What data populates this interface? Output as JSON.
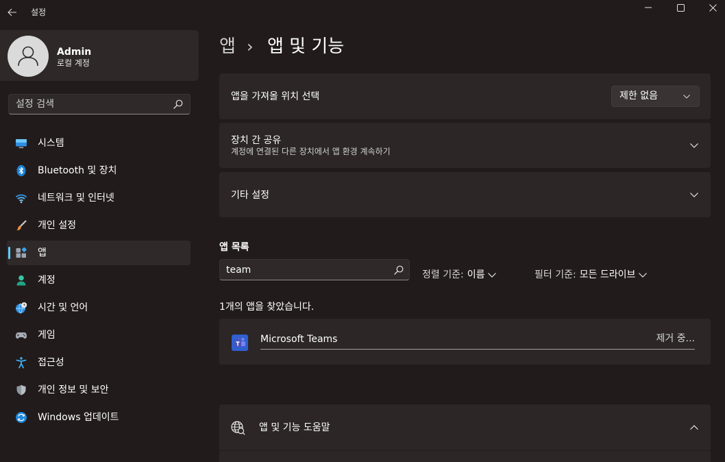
{
  "window": {
    "title": "설정"
  },
  "profile": {
    "name": "Admin",
    "account_type": "로컬 계정"
  },
  "search": {
    "placeholder": "설정 검색"
  },
  "nav": [
    {
      "label": "시스템",
      "icon": "system-icon"
    },
    {
      "label": "Bluetooth 및 장치",
      "icon": "bluetooth-icon"
    },
    {
      "label": "네트워크 및 인터넷",
      "icon": "network-icon"
    },
    {
      "label": "개인 설정",
      "icon": "personalization-icon"
    },
    {
      "label": "앱",
      "icon": "apps-icon",
      "selected": true
    },
    {
      "label": "계정",
      "icon": "accounts-icon"
    },
    {
      "label": "시간 및 언어",
      "icon": "time-language-icon"
    },
    {
      "label": "게임",
      "icon": "gaming-icon"
    },
    {
      "label": "접근성",
      "icon": "accessibility-icon"
    },
    {
      "label": "개인 정보 및 보안",
      "icon": "privacy-security-icon"
    },
    {
      "label": "Windows 업데이트",
      "icon": "windows-update-icon"
    }
  ],
  "breadcrumb": {
    "parent": "앱",
    "separator": "›",
    "current": "앱 및 기능"
  },
  "settings": {
    "install_source": {
      "label": "앱을 가져올 위치 선택",
      "selected_value": "제한 없음"
    },
    "share_across_devices": {
      "label": "장치 간 공유",
      "description": "계정에 연결된 다른 장치에서 앱 환경 계속하기"
    },
    "more_settings": {
      "label": "기타 설정"
    }
  },
  "app_list": {
    "heading": "앱 목록",
    "search_value": "team",
    "sort": {
      "label": "정렬 기준:",
      "value": "이름"
    },
    "filter": {
      "label": "필터 기준:",
      "value": "모든 드라이브"
    },
    "result_text": "1개의 앱을 찾았습니다.",
    "apps": [
      {
        "name": "Microsoft Teams",
        "status": "제거 중...",
        "icon": "teams-icon"
      }
    ]
  },
  "help": {
    "label": "앱 및 기능 도움말",
    "icon": "globe-help-icon"
  },
  "colors": {
    "accent": "#60cdff",
    "window_background": "#221b1b",
    "card_background": "#2c2626"
  }
}
